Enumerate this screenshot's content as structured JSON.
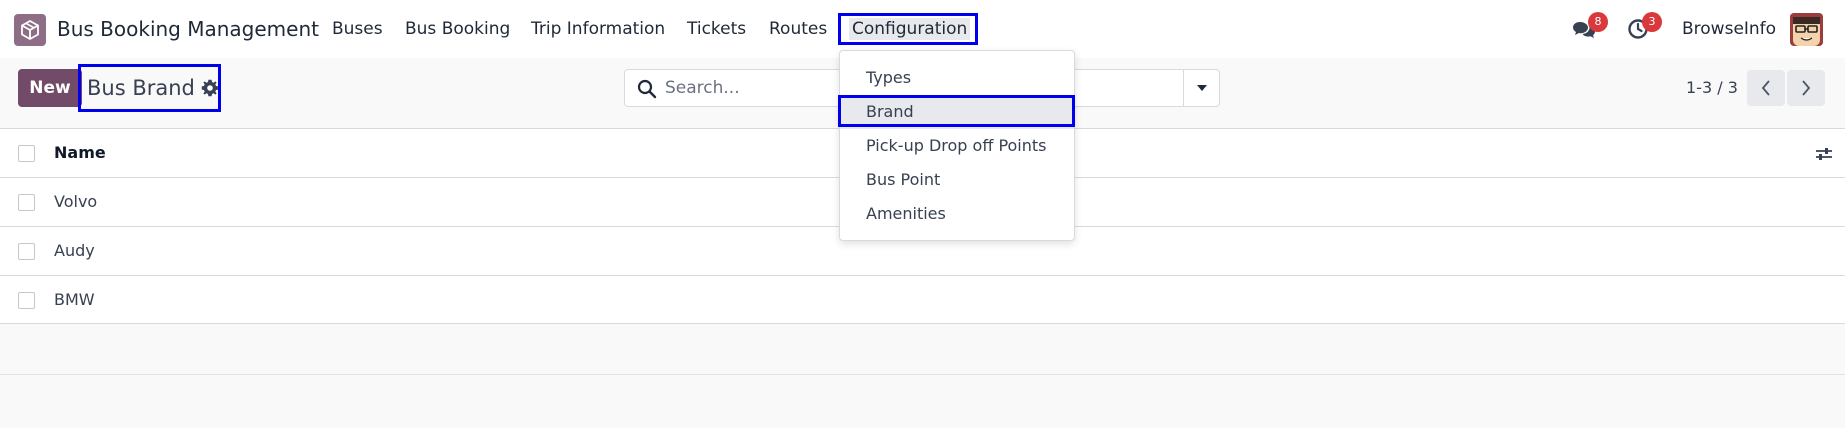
{
  "app": {
    "title": "Bus Booking Management",
    "logo_color": "#8e6e86"
  },
  "nav": {
    "items": [
      {
        "label": "Buses"
      },
      {
        "label": "Bus Booking"
      },
      {
        "label": "Trip Information"
      },
      {
        "label": "Tickets"
      },
      {
        "label": "Routes"
      },
      {
        "label": "Configuration",
        "active": true
      }
    ]
  },
  "systray": {
    "messages_count": "8",
    "activities_count": "3",
    "company": "BrowseInfo"
  },
  "control_panel": {
    "new_label": "New",
    "breadcrumb": "Bus Brand",
    "search_placeholder": "Search...",
    "pager": "1-3 / 3"
  },
  "list": {
    "columns": [
      "Name"
    ],
    "rows": [
      {
        "name": "Volvo"
      },
      {
        "name": "Audy"
      },
      {
        "name": "BMW"
      }
    ]
  },
  "dropdown": {
    "items": [
      {
        "label": "Types"
      },
      {
        "label": "Brand",
        "selected": true
      },
      {
        "label": "Pick-up Drop off Points"
      },
      {
        "label": "Bus Point"
      },
      {
        "label": "Amenities"
      }
    ]
  },
  "colors": {
    "primary": "#714b67",
    "highlight": "#0000ee",
    "badge": "#d9383d"
  }
}
